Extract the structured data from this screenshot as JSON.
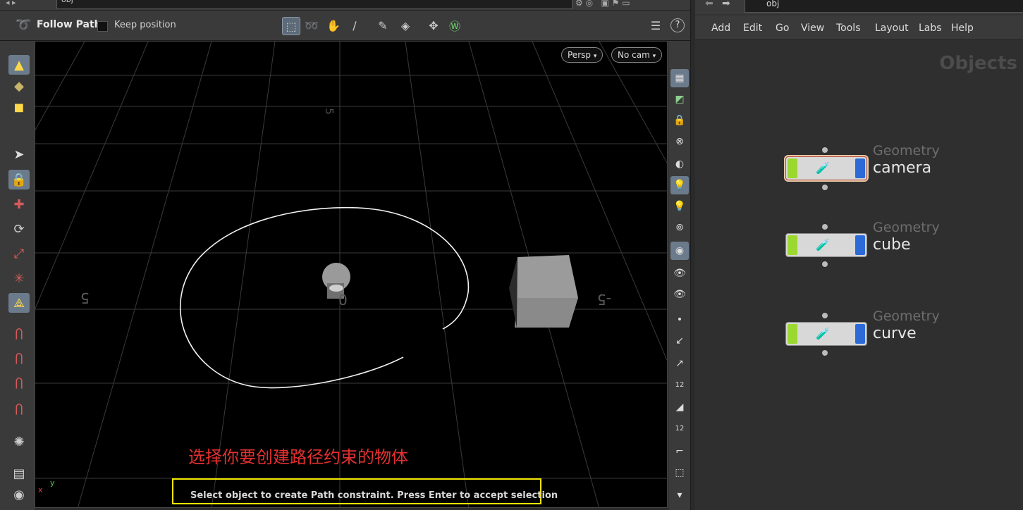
{
  "top_strip": {
    "path_text": "obj"
  },
  "tool_header": {
    "title": "Follow Path",
    "keep_position_label": "Keep position",
    "help_label": "?"
  },
  "viewport": {
    "view_button": "Persp",
    "camera_button": "No cam",
    "grid_labels": [
      "5",
      "5",
      "0",
      "-5"
    ],
    "caption": "选择你要创建路径约束的物体",
    "status": "Select object to create Path constraint. Press Enter to accept selection",
    "axis_x": "x",
    "axis_y": "y"
  },
  "right_shelf": {
    "snap_label_1": "12",
    "snap_label_2": "12"
  },
  "network": {
    "path_text": "obj",
    "menu": [
      "Add",
      "Edit",
      "Go",
      "View",
      "Tools",
      "Layout",
      "Labs",
      "Help"
    ],
    "context_label": "Objects",
    "nodes": [
      {
        "type": "Geometry",
        "name": "camera"
      },
      {
        "type": "Geometry",
        "name": "cube"
      },
      {
        "type": "Geometry",
        "name": "curve"
      }
    ]
  },
  "colors": {
    "caption": "#e33030",
    "status_highlight": "#f2e600",
    "node_flag_green": "#9bd830",
    "node_flag_blue": "#2c6ad8"
  }
}
